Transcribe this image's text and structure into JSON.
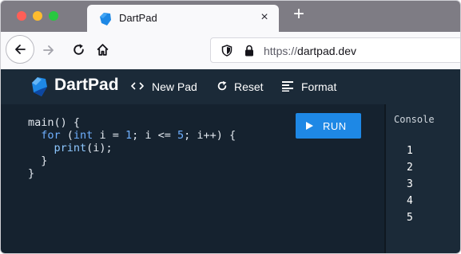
{
  "browser": {
    "tab": {
      "title": "DartPad",
      "close_glyph": "×",
      "icon": "dart-logo-icon"
    },
    "new_tab_glyph": "+",
    "url": {
      "scheme": "https://",
      "host": "dartpad.dev"
    },
    "nav_icons": [
      "back-arrow-icon",
      "forward-arrow-icon",
      "reload-icon",
      "home-icon",
      "shield-icon",
      "lock-icon"
    ]
  },
  "app": {
    "title": "DartPad",
    "toolbar": [
      {
        "label": "New Pad",
        "icon": "code-brackets-icon"
      },
      {
        "label": "Reset",
        "icon": "refresh-icon"
      },
      {
        "label": "Format",
        "icon": "align-lines-icon"
      }
    ],
    "run_label": "RUN"
  },
  "editor": {
    "lines": [
      "main() {",
      "  for (int i = 1; i <= 5; i++) {",
      "    print(i);",
      "  }",
      "}"
    ]
  },
  "console": {
    "title": "Console",
    "output": [
      "1",
      "2",
      "3",
      "4",
      "5"
    ]
  },
  "colors": {
    "tabbar_bg": "#7e7c84",
    "app_header_bg": "#1b2a38",
    "editor_bg": "#15222f",
    "run_button": "#1e88e5",
    "keyword": "#6fb0ff"
  }
}
